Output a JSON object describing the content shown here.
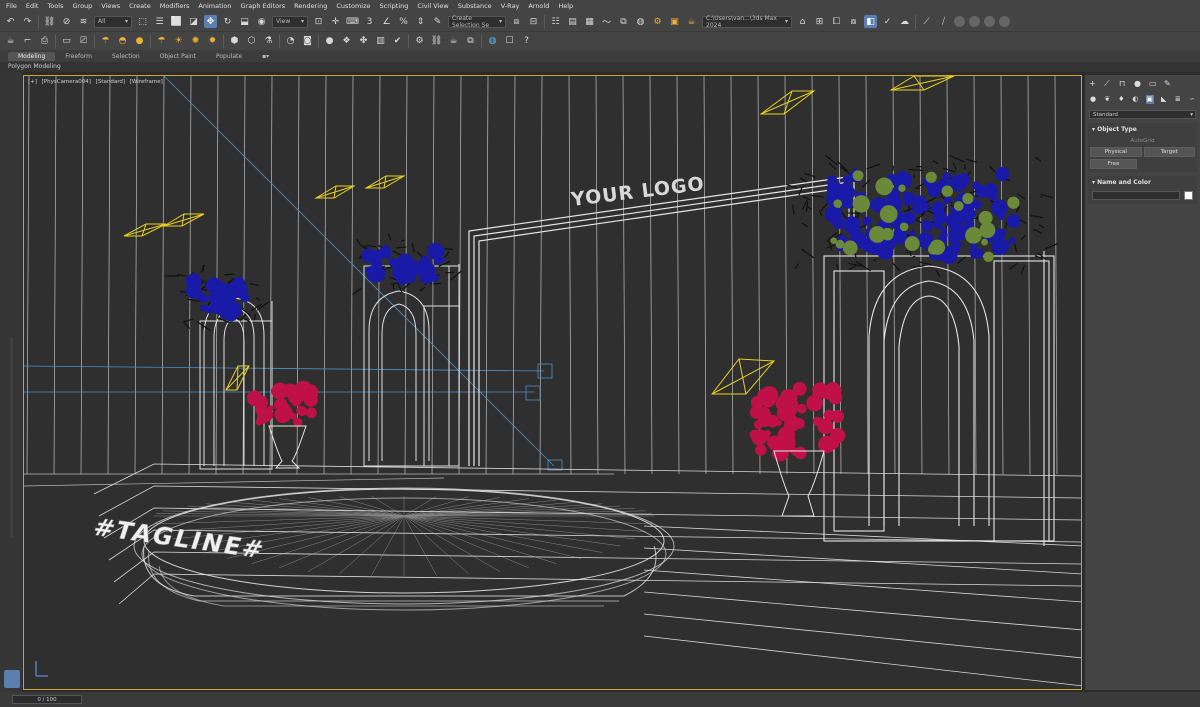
{
  "menu": [
    "File",
    "Edit",
    "Tools",
    "Group",
    "Views",
    "Create",
    "Modifiers",
    "Animation",
    "Graph Editors",
    "Rendering",
    "Customize",
    "Scripting",
    "Civil View",
    "Substance",
    "V-Ray",
    "Arnold",
    "Help"
  ],
  "toolbar": {
    "filter_value": "All",
    "view_value": "View",
    "selection_set": "Create Selection Se",
    "project_path": "C:\\Users\\van...\\3ds Max 2024"
  },
  "ribbon": {
    "tabs": [
      "Modeling",
      "Freeform",
      "Selection",
      "Object Paint",
      "Populate"
    ],
    "active_tab": "Modeling",
    "sub_label": "Polygon Modeling"
  },
  "viewport": {
    "labels": [
      "[+]",
      "[PhysCamera004]",
      "[Standard]",
      "[Wireframe]"
    ],
    "logo_text": "YOUR LOGO",
    "tagline_text": "#TAGLINE#",
    "colors": {
      "wire": "#e6e6e6",
      "light": "#e8d020",
      "guide": "#4a90c8",
      "flower_blue": "#1a1aa8",
      "flower_red": "#c0104a",
      "leaf": "#6a8a3a",
      "border": "#c8a830"
    }
  },
  "command_panel": {
    "category_value": "Standard",
    "object_type_title": "Object Type",
    "autogrid_label": "AutoGrid",
    "buttons": [
      "Physical",
      "Target",
      "Free"
    ],
    "name_color_title": "Name and Color"
  },
  "status": {
    "time_slider": "0 / 100"
  }
}
